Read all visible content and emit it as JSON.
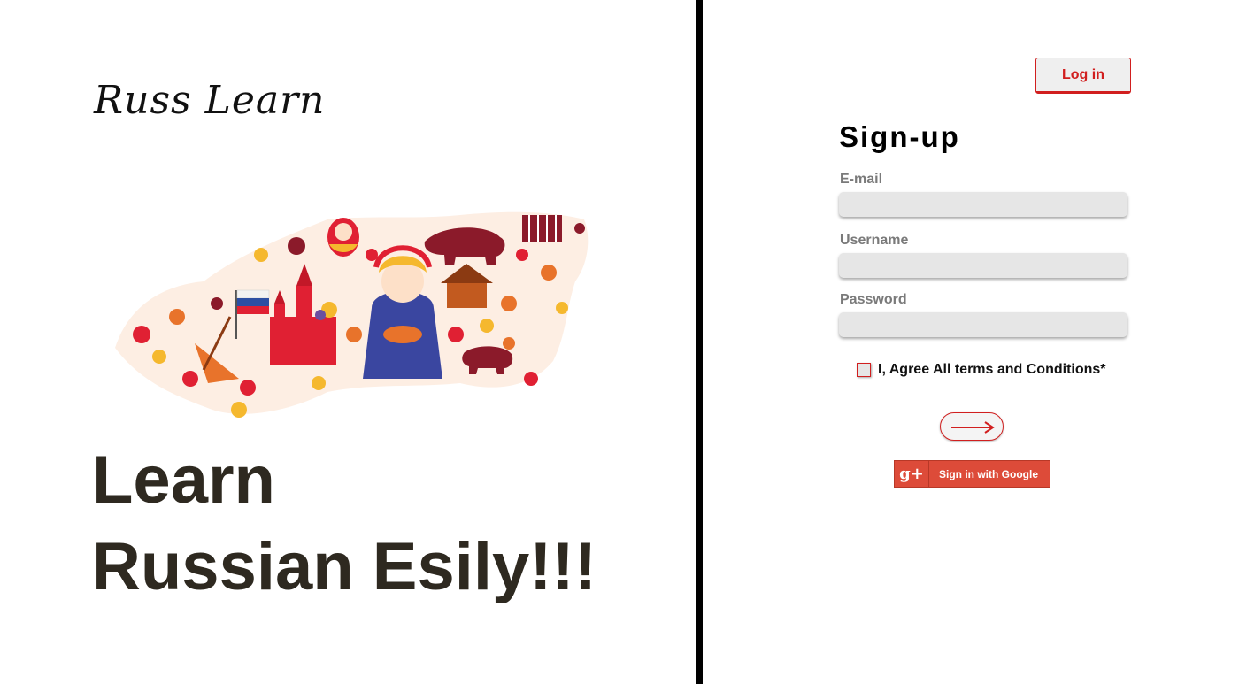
{
  "brand": {
    "logo_text": "Russ Learn"
  },
  "hero": {
    "headline_line1": "Learn",
    "headline_line2": "Russian Esily!!!"
  },
  "header": {
    "login_label": "Log in"
  },
  "signup": {
    "title": "Sign-up",
    "email_label": "E-mail",
    "username_label": "Username",
    "password_label": "Password",
    "email_value": "",
    "username_value": "",
    "password_value": "",
    "agree_label": "I, Agree All terms and Conditions*",
    "agree_checked": false,
    "submit_icon": "arrow-right-icon"
  },
  "google": {
    "label": "Sign in with Google",
    "icon_text": "g+"
  },
  "colors": {
    "accent": "#d11f1f",
    "google": "#dd4b39",
    "headline": "#2e2920",
    "field_bg": "#e6e6e6",
    "divider": "#000000"
  },
  "illustration": {
    "name": "russia-map-culture-icons"
  }
}
